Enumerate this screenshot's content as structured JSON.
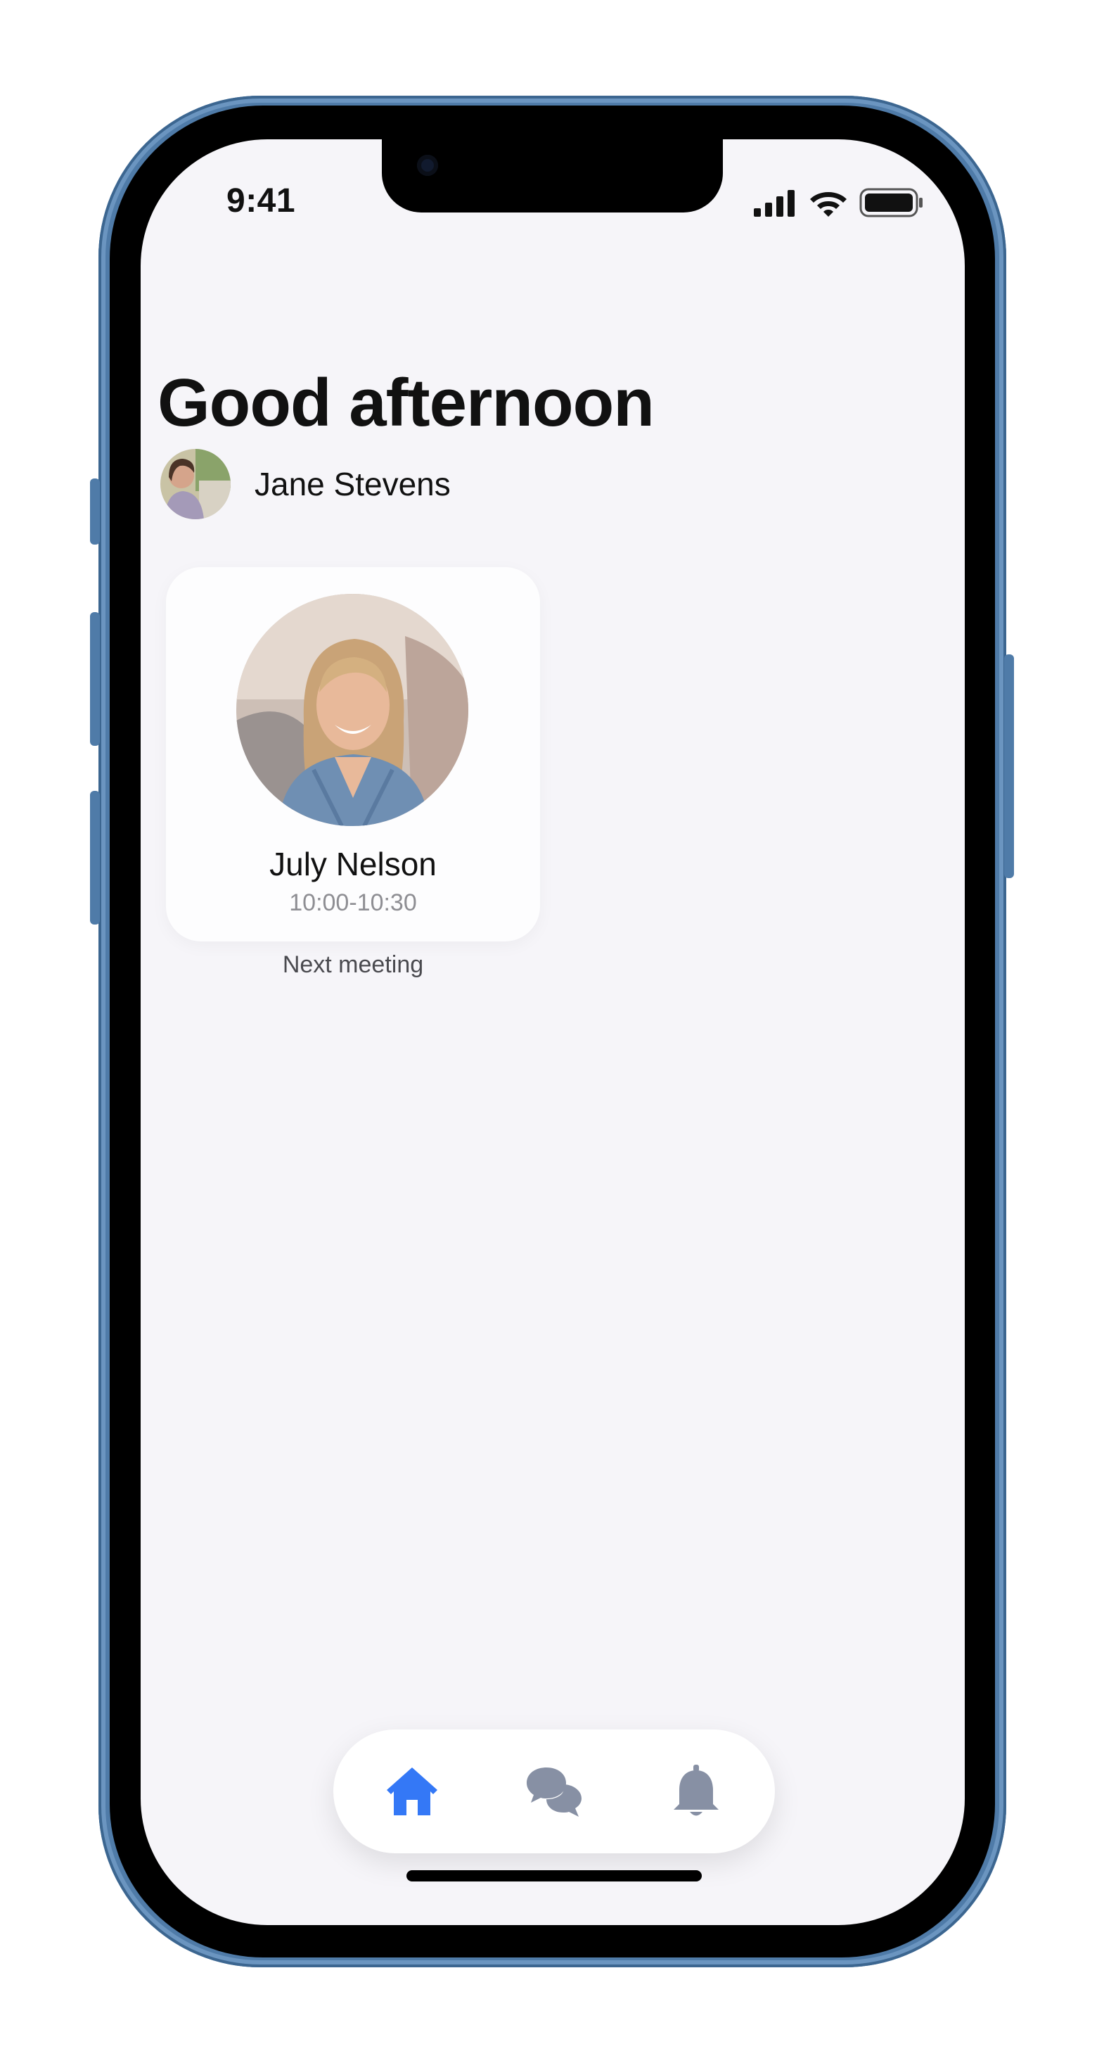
{
  "status_bar": {
    "time": "9:41",
    "signal_icon": "cellular-signal-icon",
    "wifi_icon": "wifi-icon",
    "battery_icon": "battery-icon"
  },
  "header": {
    "greeting": "Good afternoon",
    "user_name": "Jane Stevens",
    "avatar_icon": "user-avatar"
  },
  "next_meeting": {
    "name": "July Nelson",
    "time": "10:00-10:30",
    "caption": "Next meeting"
  },
  "tab_bar": {
    "tabs": [
      {
        "icon": "home-icon",
        "active": true
      },
      {
        "icon": "chat-bubbles-icon",
        "active": false
      },
      {
        "icon": "bell-icon",
        "active": false
      }
    ],
    "active_color": "#3478f6",
    "inactive_color": "#8790a4"
  }
}
